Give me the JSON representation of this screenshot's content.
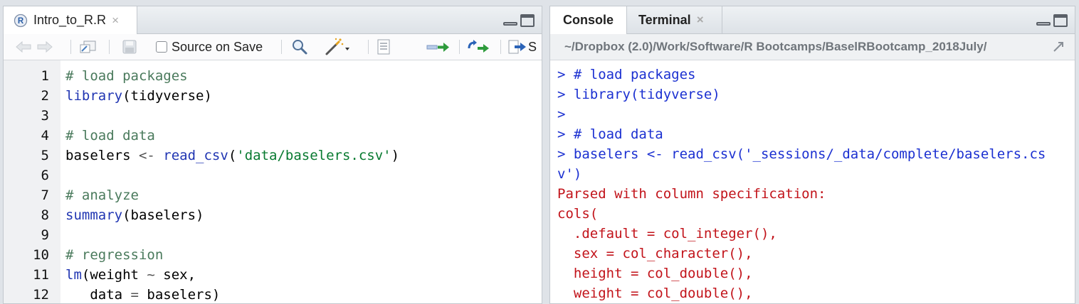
{
  "editor": {
    "tab_title": "Intro_to_R.R",
    "tab_close": "×",
    "toolbar": {
      "source_on_save_label": "Source on Save",
      "source_on_save_checked": false,
      "source_label": "S"
    },
    "lines": [
      {
        "n": "1",
        "tokens": [
          {
            "t": "# load packages",
            "c": "cm"
          }
        ]
      },
      {
        "n": "2",
        "tokens": [
          {
            "t": "library",
            "c": "fn"
          },
          {
            "t": "(tidyverse)",
            "c": "pl"
          }
        ]
      },
      {
        "n": "3",
        "tokens": []
      },
      {
        "n": "4",
        "tokens": [
          {
            "t": "# load data",
            "c": "cm"
          }
        ]
      },
      {
        "n": "5",
        "tokens": [
          {
            "t": "baselers ",
            "c": "pl"
          },
          {
            "t": "<-",
            "c": "op"
          },
          {
            "t": " ",
            "c": "pl"
          },
          {
            "t": "read_csv",
            "c": "fn"
          },
          {
            "t": "(",
            "c": "pl"
          },
          {
            "t": "'data/baselers.csv'",
            "c": "str"
          },
          {
            "t": ")",
            "c": "pl"
          }
        ]
      },
      {
        "n": "6",
        "tokens": []
      },
      {
        "n": "7",
        "tokens": [
          {
            "t": "# analyze",
            "c": "cm"
          }
        ]
      },
      {
        "n": "8",
        "tokens": [
          {
            "t": "summary",
            "c": "fn"
          },
          {
            "t": "(baselers)",
            "c": "pl"
          }
        ]
      },
      {
        "n": "9",
        "tokens": []
      },
      {
        "n": "10",
        "tokens": [
          {
            "t": "# regression",
            "c": "cm"
          }
        ]
      },
      {
        "n": "11",
        "tokens": [
          {
            "t": "lm",
            "c": "fn"
          },
          {
            "t": "(weight ",
            "c": "pl"
          },
          {
            "t": "~",
            "c": "op"
          },
          {
            "t": " sex,",
            "c": "pl"
          }
        ]
      },
      {
        "n": "12",
        "tokens": [
          {
            "t": "   data ",
            "c": "pl"
          },
          {
            "t": "=",
            "c": "op"
          },
          {
            "t": " baselers)",
            "c": "pl"
          }
        ]
      }
    ]
  },
  "console": {
    "tabs": [
      {
        "label": "Console",
        "active": true
      },
      {
        "label": "Terminal",
        "active": false,
        "close": "×"
      }
    ],
    "path": "~/Dropbox (2.0)/Work/Software/R Bootcamps/BaselRBootcamp_2018July/",
    "lines": [
      {
        "text": "> # load packages",
        "kind": "cin"
      },
      {
        "text": "> library(tidyverse)",
        "kind": "cin"
      },
      {
        "text": ">",
        "kind": "cin"
      },
      {
        "text": "> # load data",
        "kind": "cin"
      },
      {
        "text": "> baselers <- read_csv('_sessions/_data/complete/baselers.cs",
        "kind": "cin"
      },
      {
        "text": "v')",
        "kind": "cin"
      },
      {
        "text": "Parsed with column specification:",
        "kind": "cout"
      },
      {
        "text": "cols(",
        "kind": "cout"
      },
      {
        "text": "  .default = col_integer(),",
        "kind": "cout"
      },
      {
        "text": "  sex = col_character(),",
        "kind": "cout"
      },
      {
        "text": "  height = col_double(),",
        "kind": "cout"
      },
      {
        "text": "  weight = col_double(),",
        "kind": "cout"
      }
    ]
  },
  "colors": {
    "comment": "#4a7a5c",
    "function": "#2035b2",
    "string": "#087a30",
    "console_input": "#1b30d1",
    "console_output": "#c2131a"
  }
}
